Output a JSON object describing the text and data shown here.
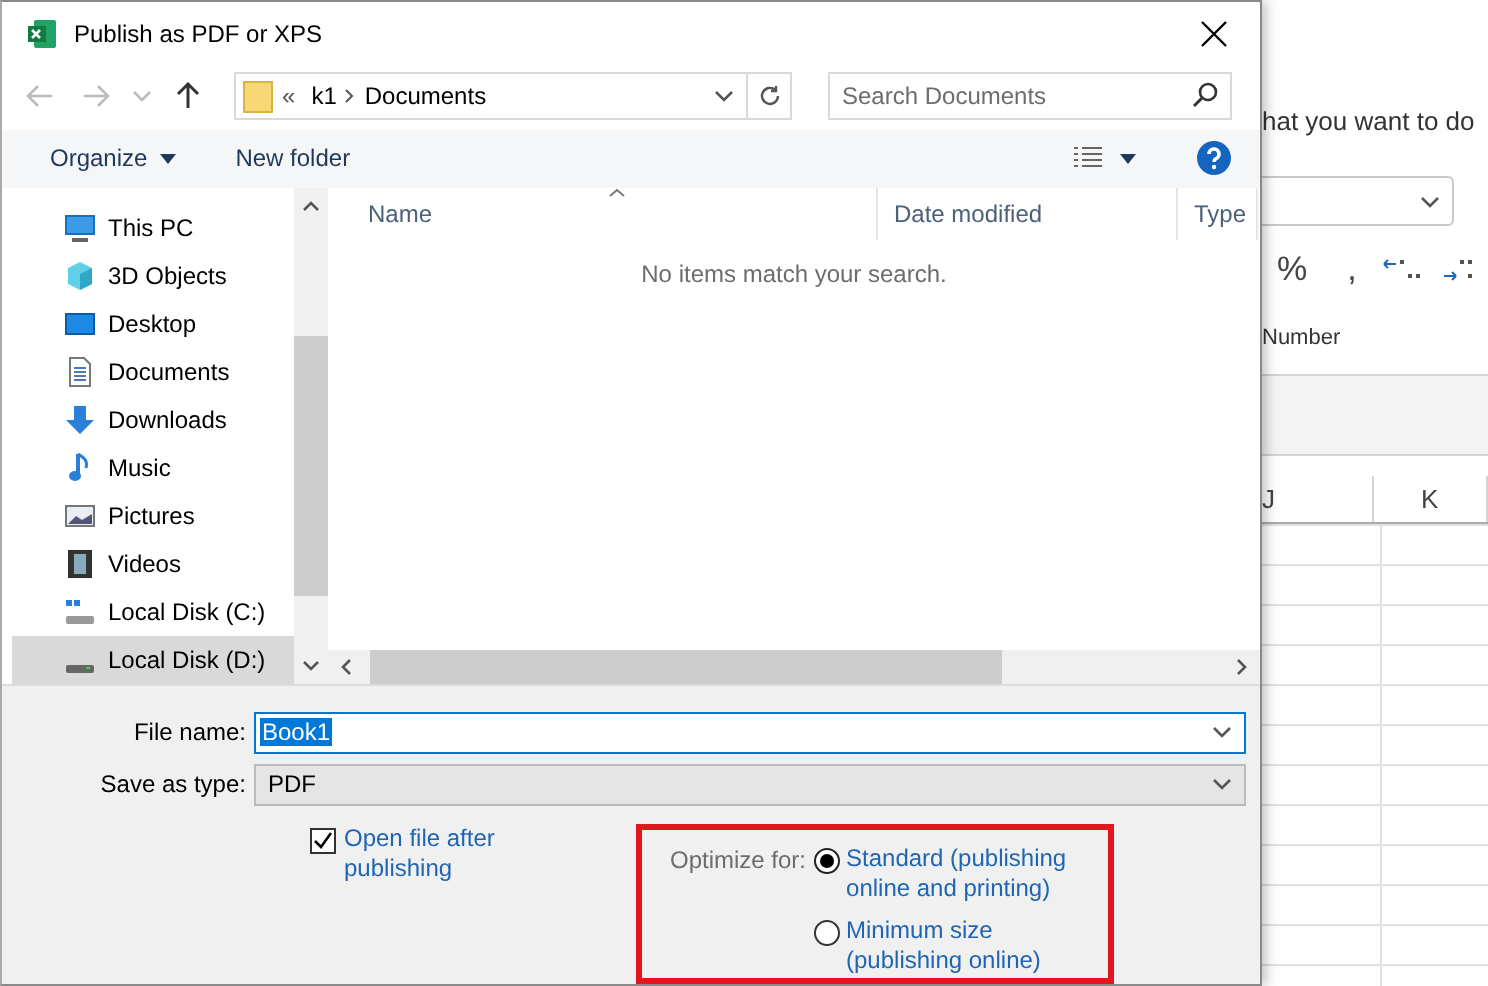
{
  "window": {
    "title": "Publish as PDF or XPS"
  },
  "address_bar": {
    "path": [
      "«",
      "k1",
      "Documents"
    ]
  },
  "search": {
    "placeholder": "Search Documents"
  },
  "toolbar": {
    "organize": "Organize",
    "new_folder": "New folder"
  },
  "sidebar": {
    "items": [
      {
        "label": "This PC",
        "kind": "pc",
        "selected": false
      },
      {
        "label": "3D Objects",
        "kind": "cube",
        "selected": false
      },
      {
        "label": "Desktop",
        "kind": "desktop",
        "selected": false
      },
      {
        "label": "Documents",
        "kind": "document",
        "selected": false
      },
      {
        "label": "Downloads",
        "kind": "download",
        "selected": false
      },
      {
        "label": "Music",
        "kind": "music",
        "selected": false
      },
      {
        "label": "Pictures",
        "kind": "pictures",
        "selected": false
      },
      {
        "label": "Videos",
        "kind": "video",
        "selected": false
      },
      {
        "label": "Local Disk (C:)",
        "kind": "systemdisk",
        "selected": false
      },
      {
        "label": "Local Disk (D:)",
        "kind": "disk",
        "selected": true
      }
    ]
  },
  "file_list": {
    "columns": [
      "Name",
      "Date modified",
      "Type"
    ],
    "empty_message": "No items match your search."
  },
  "file_name": {
    "label": "File name:",
    "value": "Book1"
  },
  "save_as_type": {
    "label": "Save as type:",
    "value": "PDF"
  },
  "open_after": {
    "label": "Open file after publishing",
    "checked": true
  },
  "optimize": {
    "label": "Optimize for:",
    "options": [
      {
        "label": "Standard (publishing online and printing)",
        "selected": true
      },
      {
        "label": "Minimum size (publishing online)",
        "selected": false
      }
    ]
  },
  "background": {
    "tell_me": "hat you want to do",
    "number_buttons": [
      "%",
      ","
    ],
    "group_label": "Number",
    "columns": [
      "J",
      "K"
    ]
  }
}
